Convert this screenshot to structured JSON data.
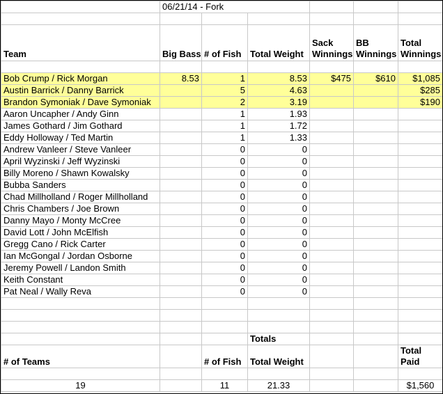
{
  "title": "06/21/14 - Fork",
  "headers": {
    "team": "Team",
    "big_bass": "Big Bass",
    "num_fish": "# of Fish",
    "total_weight": "Total Weight",
    "sack_winnings": "Sack Winnings",
    "bb_winnings": "BB Winnings",
    "total_winnings": "Total Winnings"
  },
  "rows": [
    {
      "team": "Bob Crump / Rick Morgan",
      "big_bass": "8.53",
      "fish": "1",
      "weight": "8.53",
      "sack": "$475",
      "bb": "$610",
      "total": "$1,085",
      "highlight": true
    },
    {
      "team": "Austin Barrick / Danny Barrick",
      "big_bass": "",
      "fish": "5",
      "weight": "4.63",
      "sack": "",
      "bb": "",
      "total": "$285",
      "highlight": true
    },
    {
      "team": "Brandon Symoniak / Dave Symoniak",
      "big_bass": "",
      "fish": "2",
      "weight": "3.19",
      "sack": "",
      "bb": "",
      "total": "$190",
      "highlight": true
    },
    {
      "team": "Aaron Uncapher / Andy Ginn",
      "big_bass": "",
      "fish": "1",
      "weight": "1.93",
      "sack": "",
      "bb": "",
      "total": "",
      "highlight": false
    },
    {
      "team": "James Gothard / Jim Gothard",
      "big_bass": "",
      "fish": "1",
      "weight": "1.72",
      "sack": "",
      "bb": "",
      "total": "",
      "highlight": false
    },
    {
      "team": "Eddy Holloway / Ted Martin",
      "big_bass": "",
      "fish": "1",
      "weight": "1.33",
      "sack": "",
      "bb": "",
      "total": "",
      "highlight": false
    },
    {
      "team": "Andrew Vanleer / Steve Vanleer",
      "big_bass": "",
      "fish": "0",
      "weight": "0",
      "sack": "",
      "bb": "",
      "total": "",
      "highlight": false
    },
    {
      "team": "April Wyzinski / Jeff Wyzinski",
      "big_bass": "",
      "fish": "0",
      "weight": "0",
      "sack": "",
      "bb": "",
      "total": "",
      "highlight": false
    },
    {
      "team": "Billy Moreno / Shawn Kowalsky",
      "big_bass": "",
      "fish": "0",
      "weight": "0",
      "sack": "",
      "bb": "",
      "total": "",
      "highlight": false
    },
    {
      "team": "Bubba Sanders",
      "big_bass": "",
      "fish": "0",
      "weight": "0",
      "sack": "",
      "bb": "",
      "total": "",
      "highlight": false
    },
    {
      "team": "Chad Millholland / Roger Millholland",
      "big_bass": "",
      "fish": "0",
      "weight": "0",
      "sack": "",
      "bb": "",
      "total": "",
      "highlight": false
    },
    {
      "team": "Chris Chambers / Joe Brown",
      "big_bass": "",
      "fish": "0",
      "weight": "0",
      "sack": "",
      "bb": "",
      "total": "",
      "highlight": false
    },
    {
      "team": "Danny Mayo / Monty McCree",
      "big_bass": "",
      "fish": "0",
      "weight": "0",
      "sack": "",
      "bb": "",
      "total": "",
      "highlight": false
    },
    {
      "team": "David Lott / John McElfish",
      "big_bass": "",
      "fish": "0",
      "weight": "0",
      "sack": "",
      "bb": "",
      "total": "",
      "highlight": false
    },
    {
      "team": "Gregg Cano / Rick Carter",
      "big_bass": "",
      "fish": "0",
      "weight": "0",
      "sack": "",
      "bb": "",
      "total": "",
      "highlight": false
    },
    {
      "team": "Ian McGongal / Jordan Osborne",
      "big_bass": "",
      "fish": "0",
      "weight": "0",
      "sack": "",
      "bb": "",
      "total": "",
      "highlight": false
    },
    {
      "team": "Jeremy Powell / Landon Smith",
      "big_bass": "",
      "fish": "0",
      "weight": "0",
      "sack": "",
      "bb": "",
      "total": "",
      "highlight": false
    },
    {
      "team": "Keith Constant",
      "big_bass": "",
      "fish": "0",
      "weight": "0",
      "sack": "",
      "bb": "",
      "total": "",
      "highlight": false
    },
    {
      "team": "Pat Neal / Wally Reva",
      "big_bass": "",
      "fish": "0",
      "weight": "0",
      "sack": "",
      "bb": "",
      "total": "",
      "highlight": false
    }
  ],
  "totals": {
    "label": "Totals",
    "num_teams_label": "# of Teams",
    "num_fish_label": "# of Fish",
    "total_weight_label": "Total Weight",
    "total_paid_label": "Total Paid",
    "num_teams": "19",
    "num_fish": "11",
    "total_weight": "21.33",
    "total_paid": "$1,560"
  },
  "colors": {
    "highlight": "#ffff99",
    "gridline": "#c8c8c8"
  }
}
